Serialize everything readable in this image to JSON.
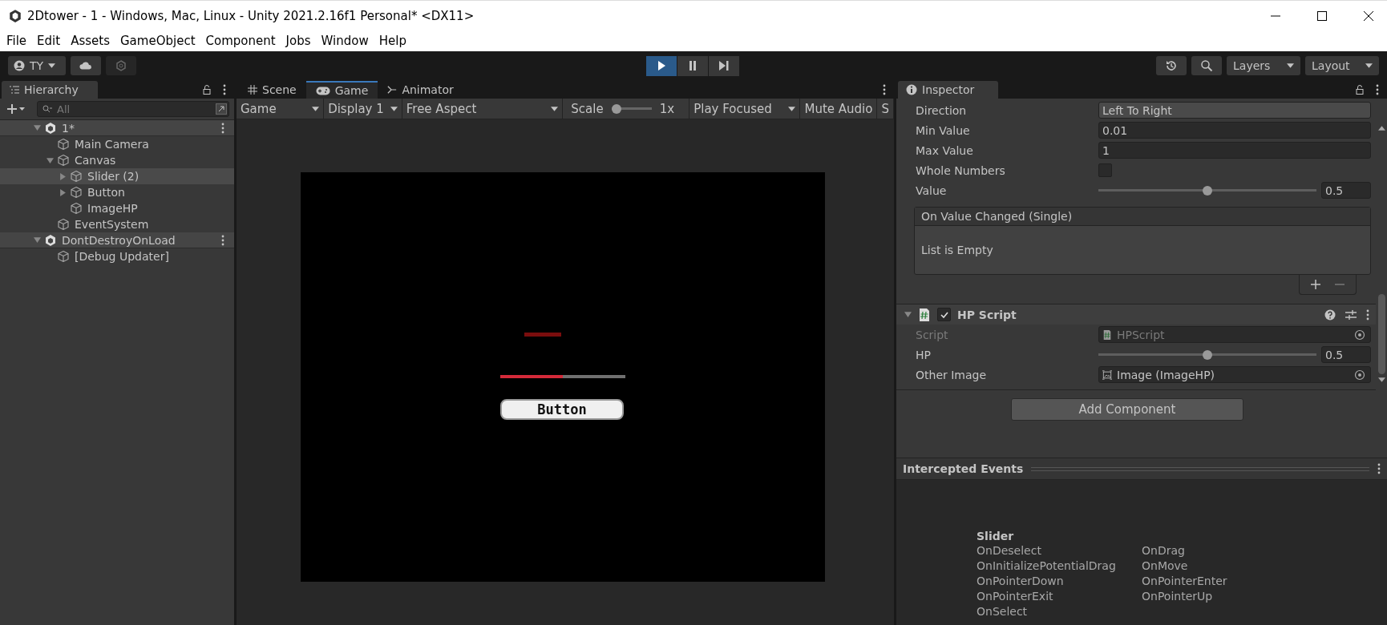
{
  "window": {
    "title": "2Dtower - 1 - Windows, Mac, Linux - Unity 2021.2.16f1 Personal* <DX11>"
  },
  "menu": [
    "File",
    "Edit",
    "Assets",
    "GameObject",
    "Component",
    "Jobs",
    "Window",
    "Help"
  ],
  "toolbar": {
    "account": "TY",
    "play": {
      "on": true
    },
    "pause": {
      "on": false
    },
    "step": {
      "on": false
    },
    "layers": "Layers",
    "layout": "Layout"
  },
  "hierarchy": {
    "title": "Hierarchy",
    "search": {
      "placeholder": "All"
    },
    "items": [
      {
        "label": "1*",
        "kind": "scene",
        "expanded": true,
        "selected": false,
        "children": [
          {
            "label": "Main Camera",
            "kind": "object",
            "selected": false
          },
          {
            "label": "Canvas",
            "kind": "object",
            "expanded": true,
            "selected": false,
            "children": [
              {
                "label": "Slider (2)",
                "kind": "object",
                "expanded": false,
                "selected": true
              },
              {
                "label": "Button",
                "kind": "object",
                "expanded": false,
                "selected": false
              },
              {
                "label": "ImageHP",
                "kind": "object",
                "selected": false
              }
            ]
          },
          {
            "label": "EventSystem",
            "kind": "object",
            "selected": false
          }
        ]
      },
      {
        "label": "DontDestroyOnLoad",
        "kind": "scene",
        "expanded": true,
        "selected": false,
        "children": [
          {
            "label": "[Debug Updater]",
            "kind": "object",
            "selected": false
          }
        ]
      }
    ]
  },
  "game": {
    "tabs": [
      {
        "label": "Scene",
        "selected": false
      },
      {
        "label": "Game",
        "selected": true
      },
      {
        "label": "Animator",
        "selected": false
      }
    ],
    "toolbar": [
      {
        "kind": "dropdown",
        "label": "Game"
      },
      {
        "kind": "dropdown",
        "label": "Display 1"
      },
      {
        "kind": "dropdown",
        "label": "Free Aspect"
      },
      {
        "kind": "scale",
        "label": "Scale",
        "level": 0,
        "reading": "1x"
      },
      {
        "kind": "dropdown",
        "label": "Play Focused"
      },
      {
        "kind": "toggle",
        "label": "Mute Audio"
      },
      {
        "kind": "toggle",
        "label": "S"
      }
    ],
    "view": {
      "slider": {
        "level": 0.5
      },
      "button": "Button"
    }
  },
  "inspector": {
    "title": "Inspector",
    "fields": [
      {
        "kind": "dropdown",
        "label": "Direction",
        "value": "Left To Right"
      },
      {
        "kind": "text",
        "label": "Min Value",
        "value": "0.01"
      },
      {
        "kind": "text",
        "label": "Max Value",
        "value": "1"
      },
      {
        "kind": "checkbox",
        "label": "Whole Numbers",
        "checked": false
      },
      {
        "kind": "slider",
        "label": "Value",
        "level": 0.5,
        "value": "0.5"
      }
    ],
    "event": {
      "title": "On Value Changed (Single)",
      "empty": "List is Empty"
    },
    "component": {
      "title": "HP Script",
      "enabled": true,
      "fields": [
        {
          "kind": "script_ref",
          "label": "Script",
          "value": "HPScript",
          "disabled": true
        },
        {
          "kind": "slider",
          "label": "HP",
          "level": 0.5,
          "value": "0.5"
        },
        {
          "kind": "image_ref",
          "label": "Other Image",
          "value": "Image (ImageHP)",
          "disabled": false
        }
      ]
    },
    "add_button": "Add Component"
  },
  "intercepted": {
    "title": "Intercepted Events",
    "group": "Slider",
    "events": [
      "OnDeselect",
      "OnInitializePotentialDrag",
      "OnPointerDown",
      "OnPointerExit",
      "OnSelect",
      "OnDrag",
      "OnMove",
      "OnPointerEnter",
      "OnPointerUp"
    ]
  }
}
